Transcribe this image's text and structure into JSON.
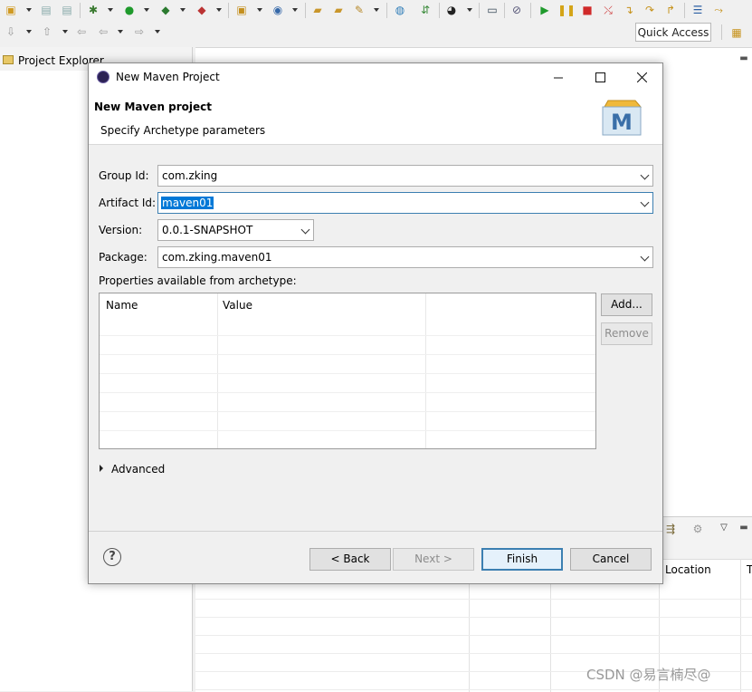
{
  "ide": {
    "quick_access_label": "Quick Access",
    "project_explorer_tab": "Project Explorer",
    "bottom_columns": [
      "Location",
      "T"
    ],
    "watermark": "CSDN @易言楠尽@"
  },
  "dialog": {
    "title": "New Maven Project",
    "banner_title": "New Maven project",
    "banner_subtitle": "Specify Archetype parameters",
    "logo_letter": "M",
    "fields": {
      "group_id": {
        "label": "Group Id:",
        "value": "com.zking"
      },
      "artifact_id": {
        "label": "Artifact Id:",
        "value": "maven01"
      },
      "version": {
        "label": "Version:",
        "value": "0.0.1-SNAPSHOT"
      },
      "package": {
        "label": "Package:",
        "value": "com.zking.maven01"
      }
    },
    "properties_label": "Properties available from archetype:",
    "table_headers": [
      "Name",
      "Value"
    ],
    "add_button": "Add...",
    "remove_button": "Remove",
    "advanced_label": "Advanced",
    "buttons": {
      "back": "< Back",
      "next": "Next >",
      "finish": "Finish",
      "cancel": "Cancel"
    },
    "help_symbol": "?"
  }
}
